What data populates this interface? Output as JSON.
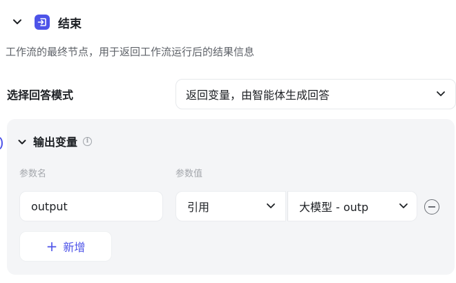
{
  "node": {
    "title": "结束",
    "description": "工作流的最终节点，用于返回工作流运行后的结果信息"
  },
  "answer_mode": {
    "label": "选择回答模式",
    "selected": "返回变量，由智能体生成回答"
  },
  "output_vars": {
    "title": "输出变量",
    "col_name": "参数名",
    "col_value": "参数值",
    "rows": [
      {
        "name": "output",
        "source_type": "引用",
        "source_var": "大模型 - outp"
      }
    ],
    "add_label": "新增"
  },
  "colors": {
    "accent": "#4d53e8",
    "panel_bg": "#f4f5f7"
  }
}
